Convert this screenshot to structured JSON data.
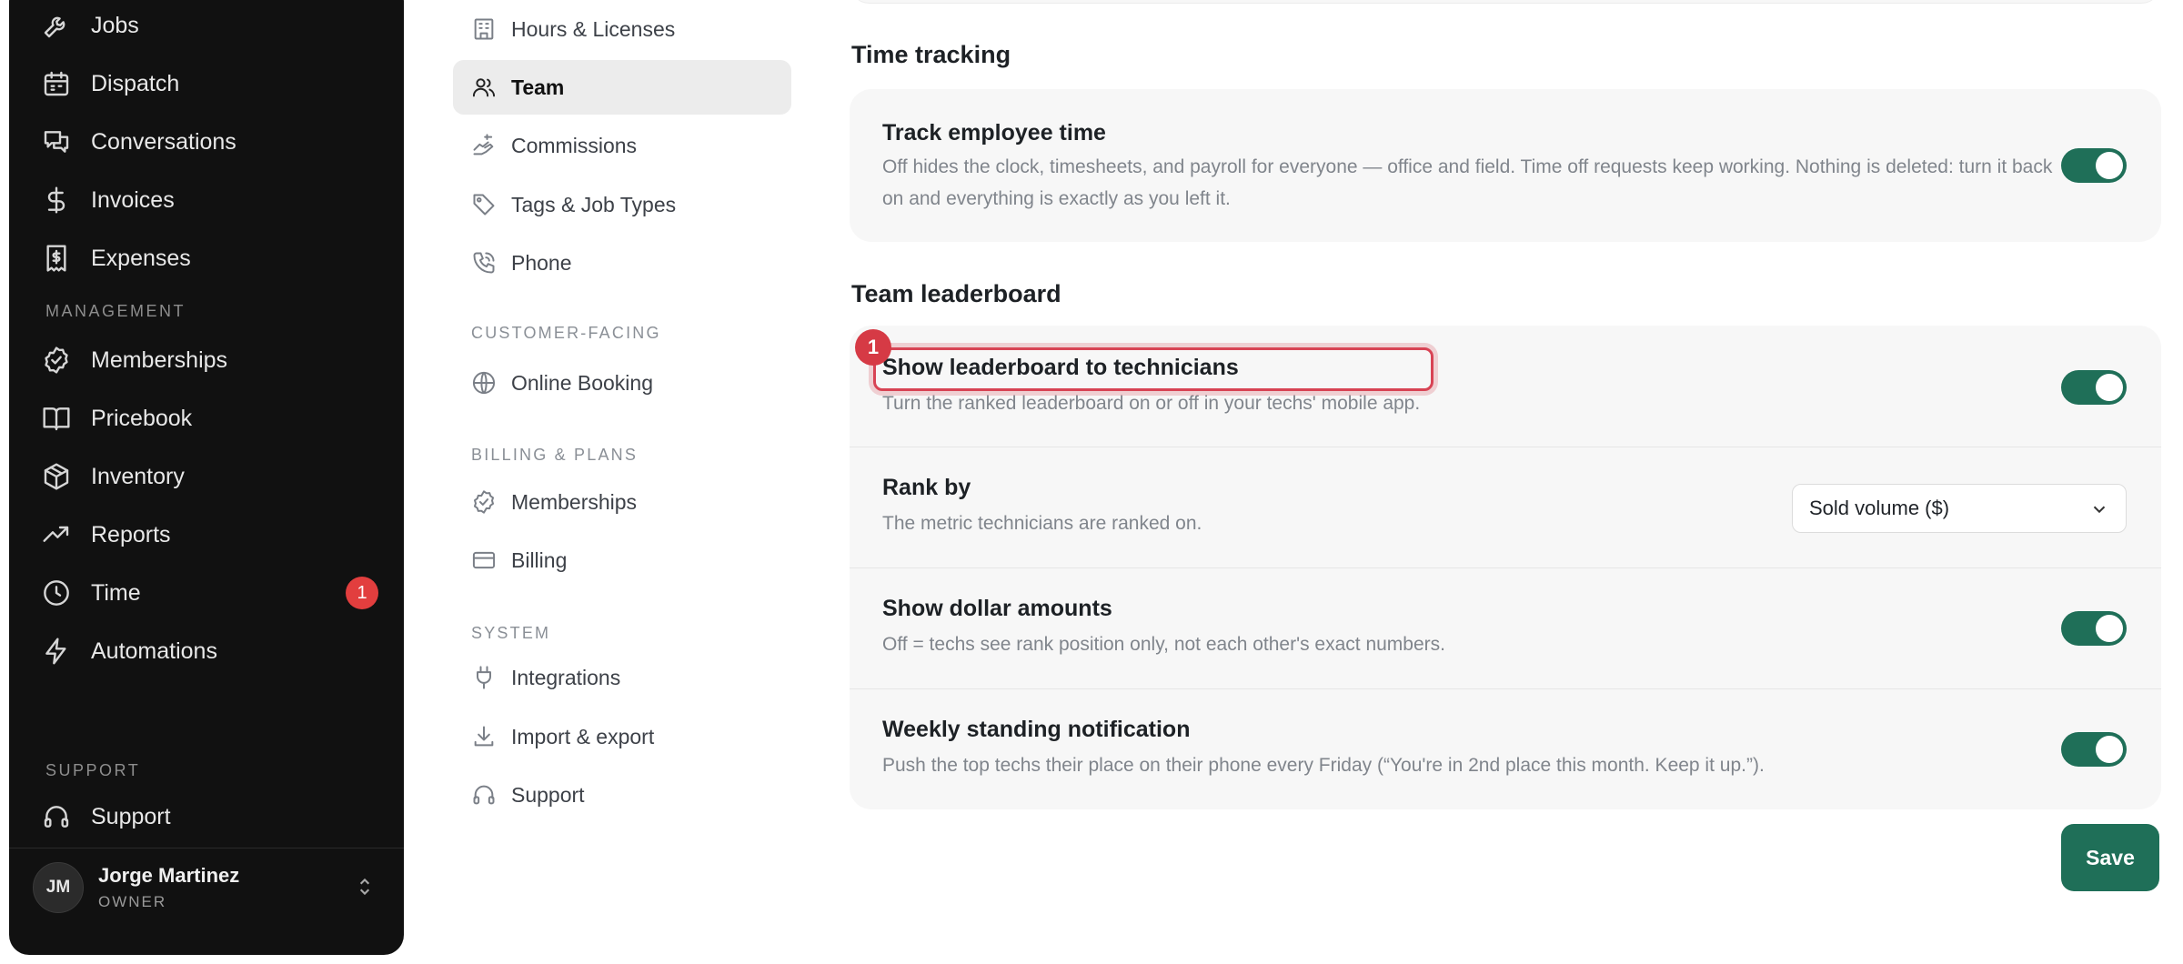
{
  "sidebar": {
    "items_top": [
      {
        "label": "Jobs",
        "icon": "wrench-icon"
      },
      {
        "label": "Dispatch",
        "icon": "calendar-icon"
      },
      {
        "label": "Conversations",
        "icon": "chat-icon"
      },
      {
        "label": "Invoices",
        "icon": "dollar-icon"
      },
      {
        "label": "Expenses",
        "icon": "receipt-icon"
      }
    ],
    "management_label": "MANAGEMENT",
    "items_management": [
      {
        "label": "Memberships",
        "icon": "check-circle-icon"
      },
      {
        "label": "Pricebook",
        "icon": "book-icon"
      },
      {
        "label": "Inventory",
        "icon": "box-icon"
      },
      {
        "label": "Reports",
        "icon": "trend-icon"
      },
      {
        "label": "Time",
        "icon": "clock-icon",
        "badge": "1"
      },
      {
        "label": "Automations",
        "icon": "bolt-icon"
      }
    ],
    "support_label": "SUPPORT",
    "support_item": {
      "label": "Support",
      "icon": "headset-icon"
    },
    "user": {
      "initials": "JM",
      "name": "Jorge Martinez",
      "role": "OWNER"
    }
  },
  "subnav": {
    "items_a": [
      {
        "label": "Hours & Licenses",
        "icon": "building-icon"
      },
      {
        "label": "Team",
        "icon": "users-icon",
        "active": true
      },
      {
        "label": "Commissions",
        "icon": "coins-icon"
      },
      {
        "label": "Tags & Job Types",
        "icon": "tag-icon"
      },
      {
        "label": "Phone",
        "icon": "phone-icon"
      }
    ],
    "customer_facing_label": "CUSTOMER-FACING",
    "items_b": [
      {
        "label": "Online Booking",
        "icon": "globe-icon"
      }
    ],
    "billing_label": "BILLING & PLANS",
    "items_c": [
      {
        "label": "Memberships",
        "icon": "check-circle-icon"
      },
      {
        "label": "Billing",
        "icon": "card-icon"
      }
    ],
    "system_label": "SYSTEM",
    "items_d": [
      {
        "label": "Integrations",
        "icon": "plug-icon"
      },
      {
        "label": "Import & export",
        "icon": "download-icon"
      },
      {
        "label": "Support",
        "icon": "headset-icon"
      }
    ]
  },
  "time_tracking": {
    "title": "Time tracking",
    "row_title": "Track employee time",
    "row_desc": "Off hides the clock, timesheets, and payroll for everyone — office and field. Time off requests keep working. Nothing is deleted: turn it back on and everything is exactly as you left it.",
    "enabled": true
  },
  "leaderboard": {
    "title": "Team leaderboard",
    "show": {
      "title": "Show leaderboard to technicians",
      "desc": "Turn the ranked leaderboard on or off in your techs' mobile app.",
      "enabled": true
    },
    "rank_by": {
      "title": "Rank by",
      "desc": "The metric technicians are ranked on.",
      "value": "Sold volume ($)"
    },
    "dollars": {
      "title": "Show dollar amounts",
      "desc": "Off = techs see rank position only, not each other's exact numbers.",
      "enabled": true
    },
    "weekly": {
      "title": "Weekly standing notification",
      "desc": "Push the top techs their place on their phone every Friday (“You're in 2nd place this month. Keep it up.”).",
      "enabled": true
    }
  },
  "annotation": {
    "badge": "1"
  },
  "save_label": "Save",
  "colors": {
    "accent": "#1f6f58",
    "badge": "#e23e3e",
    "highlight": "#d84354"
  }
}
